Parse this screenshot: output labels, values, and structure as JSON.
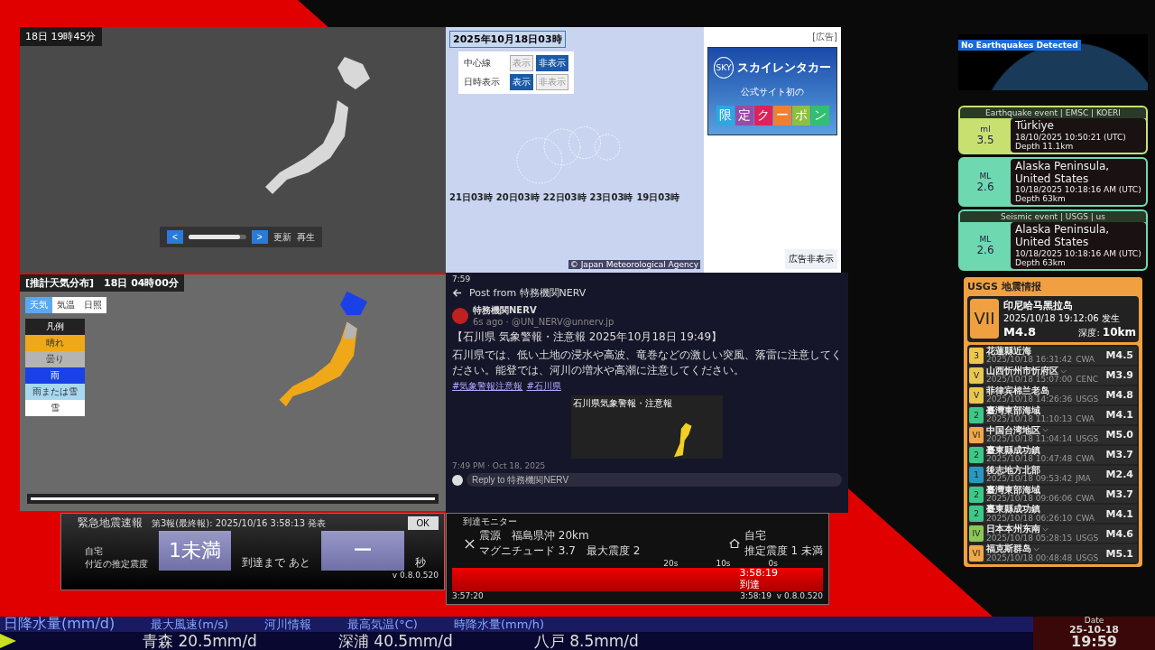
{
  "radar_map": {
    "time": "18日 19時45分",
    "prev": "<",
    "next": ">",
    "refresh": "更新",
    "play": "再生",
    "level": 0.9
  },
  "typhoon_map": {
    "date": "2025年10月18日03時",
    "controls": [
      {
        "label": "中心線",
        "options": [
          {
            "label": "表示",
            "selected": false
          },
          {
            "label": "非表示",
            "selected": true
          }
        ]
      },
      {
        "label": "日時表示",
        "options": [
          {
            "label": "表示",
            "selected": true
          },
          {
            "label": "非表示",
            "selected": false
          }
        ]
      }
    ],
    "track_labels": [
      "21日03時",
      "20日03時",
      "22日03時",
      "23日03時",
      "19日03時"
    ],
    "credit": "© Japan Meteorological Agency",
    "ad": {
      "tag": "[広告]",
      "logo": "SKY",
      "brand": "スカイレンタカー",
      "tagline": "公式サイト初の",
      "coupon": [
        {
          "char": "限",
          "color": "#2aa8e0"
        },
        {
          "char": "定",
          "color": "#9a4aa8"
        },
        {
          "char": "ク",
          "color": "#e0205a"
        },
        {
          "char": "ー",
          "color": "#f08030"
        },
        {
          "char": "ポ",
          "color": "#8cc040"
        },
        {
          "char": "ン",
          "color": "#30c070"
        }
      ],
      "hide": "広告非表示"
    }
  },
  "weather_map": {
    "title": "[推計天気分布]　18日 04時00分",
    "tabs": [
      {
        "label": "天気",
        "selected": true
      },
      {
        "label": "気温",
        "selected": false
      },
      {
        "label": "日照",
        "selected": false
      }
    ],
    "legend_title": "凡例",
    "legend": [
      {
        "label": "晴れ",
        "color": "#f0a818"
      },
      {
        "label": "曇り",
        "color": "#b4b4b4"
      },
      {
        "label": "雨",
        "color": "#1a40e8"
      },
      {
        "label": "雨または雪",
        "color": "#a8d8f0"
      },
      {
        "label": "雪",
        "color": "#ffffff"
      }
    ],
    "level": 1.0
  },
  "post": {
    "clock": "7:59",
    "header": "Post from 特務機関NERV",
    "author": "特務機関NERV",
    "meta": "6s ago · @UN_NERV@unnerv.jp",
    "headline": "【石川県 気象警報・注意報 2025年10月18日 19:49】",
    "body": "石川県では、低い土地の浸水や高波、竜巻などの激しい突風、落雷に注意してください。能登では、河川の増水や高潮に注意してください。",
    "hashtags": [
      "#気象警報注意報",
      "#石川県"
    ],
    "image_title": "石川県気象警報・注意報",
    "timestamp": "7:49 PM · Oct 18, 2025",
    "reply_placeholder": "Reply to 特務機関NERV"
  },
  "eew": {
    "title": "緊急地震速報",
    "report": "第3報(最終報): 2025/10/16 3:58:13 発表",
    "ok": "OK",
    "place": "自宅",
    "intensity_label": "付近の推定震度",
    "intensity": "1未満",
    "arrival_label": "到達まで あと",
    "arrival": "ー",
    "unit": "秒",
    "version": "v 0.8.0.520"
  },
  "arrival_monitor": {
    "title": "到達モニター",
    "epicenter": "震源　福島県沖 20km",
    "magnitude": "マグニチュード 3.7　最大震度 2",
    "home": "自宅",
    "home_intensity": "推定震度 1 未満",
    "ticks": [
      "20s",
      "10s",
      "0s"
    ],
    "arrive_time": "3:58:19",
    "arrive_label": "到達",
    "start": "3:57:20",
    "end": "3:58:19",
    "version": "v 0.8.0.520"
  },
  "globe": {
    "status": "No Earthquakes Detected"
  },
  "events": [
    {
      "header": "Earthquake event | EMSC | KOERI",
      "scale": "ml",
      "mag": "3.5",
      "place": "Türkiye",
      "time": "18/10/2025 10:50:21 (UTC)",
      "depth": "Depth 11.1km",
      "color": "#c8e070"
    },
    {
      "scale": "ML",
      "mag": "2.6",
      "place": "Alaska Peninsula, United States",
      "time": "10/18/2025 10:18:16 AM (UTC)",
      "depth": "Depth 63km",
      "color": "#6ed8b0"
    },
    {
      "header": "Seismic event | USGS | us",
      "scale": "ML",
      "mag": "2.6",
      "place": "Alaska Peninsula, United States",
      "time": "10/18/2025 10:18:16 AM (UTC)",
      "depth": "Depth 63km",
      "color": "#6ed8b0"
    }
  ],
  "usgs": {
    "title": "USGS 地震情报",
    "latest": {
      "intensity": "VII",
      "place": "印尼哈马黑拉岛",
      "time": "2025/10/18 19:12:06 发生",
      "mag": "M4.8",
      "depth_label": "深度:",
      "depth": "10km"
    },
    "list": [
      {
        "intensity": "3",
        "color": "#f0c848",
        "place": "花蓮縣近海",
        "time": "2025/10/18 16:31:42",
        "source": "CWA",
        "mag": "M4.5",
        "expandable": false
      },
      {
        "intensity": "V",
        "color": "#e8c850",
        "place": "山西忻州市忻府区",
        "time": "2025/10/18 15:07:00",
        "source": "CENC",
        "mag": "M3.9",
        "expandable": true
      },
      {
        "intensity": "V",
        "color": "#e8c850",
        "place": "菲律宾棉兰老岛",
        "time": "2025/10/18 14:26:36",
        "source": "USGS",
        "mag": "M4.8",
        "expandable": false
      },
      {
        "intensity": "2",
        "color": "#3cc888",
        "place": "臺灣東部海域",
        "time": "2025/10/18 11:10:13",
        "source": "CWA",
        "mag": "M4.1",
        "expandable": false
      },
      {
        "intensity": "VI",
        "color": "#f0a848",
        "place": "中国台湾地区",
        "time": "2025/10/18 11:04:14",
        "source": "USGS",
        "mag": "M5.0",
        "expandable": true
      },
      {
        "intensity": "2",
        "color": "#3cc888",
        "place": "臺東縣成功鎮",
        "time": "2025/10/18 10:47:48",
        "source": "CWA",
        "mag": "M3.7",
        "expandable": false
      },
      {
        "intensity": "1",
        "color": "#2898c0",
        "place": "後志地方北部",
        "time": "2025/10/18 09:53:42",
        "source": "JMA",
        "mag": "M2.4",
        "expandable": false
      },
      {
        "intensity": "2",
        "color": "#3cc888",
        "place": "臺灣東部海域",
        "time": "2025/10/18 09:06:06",
        "source": "CWA",
        "mag": "M3.7",
        "expandable": false
      },
      {
        "intensity": "2",
        "color": "#3cc888",
        "place": "臺東縣成功鎮",
        "time": "2025/10/18 06:26:10",
        "source": "CWA",
        "mag": "M4.1",
        "expandable": false
      },
      {
        "intensity": "IV",
        "color": "#8cc858",
        "place": "日本本州东南",
        "time": "2025/10/18 05:28:15",
        "source": "USGS",
        "mag": "M4.6",
        "expandable": true
      },
      {
        "intensity": "VI",
        "color": "#f0a848",
        "place": "福克斯群岛",
        "time": "2025/10/18 00:48:48",
        "source": "USGS",
        "mag": "M5.1",
        "expandable": true
      }
    ]
  },
  "ticker": {
    "categories": [
      "日降水量(mm/d)",
      "最大風速(m/s)",
      "河川情報",
      "最高気温(°C)",
      "時降水量(mm/h)"
    ],
    "items": [
      "青森 20.5mm/d",
      "深浦 40.5mm/d",
      "八戸 8.5mm/d"
    ],
    "date_label": "Date",
    "date": "25-10-18",
    "time": "19:59"
  }
}
